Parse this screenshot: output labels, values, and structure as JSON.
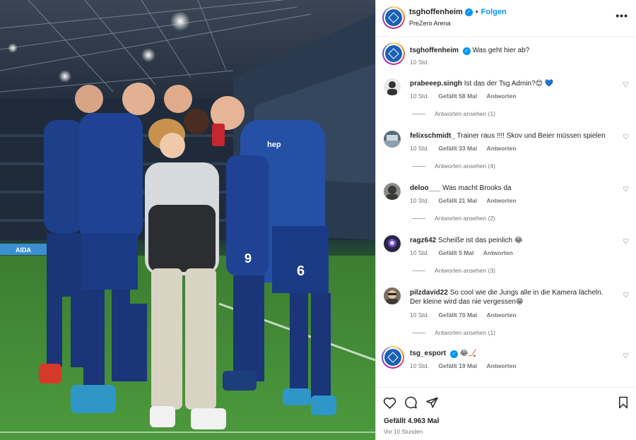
{
  "post": {
    "username": "tsghoffenheim",
    "follow_label": "Folgen",
    "location": "PreZero Arena",
    "more_label": "•••"
  },
  "caption": {
    "username": "tsghoffenheim",
    "text": "Was geht hier ab?",
    "time": "10 Std."
  },
  "comments": [
    {
      "username": "prabeeep.singh",
      "text": "Ist das der Tsg Admin?😊 💙",
      "time": "10 Std.",
      "likes": "Gefällt 58 Mal",
      "reply": "Antworten",
      "view_replies": "Antworten ansehen (1)",
      "avatar_color": "#e8e8e8"
    },
    {
      "username": "felixschmidt_",
      "text": "Trainer raus !!!! Skov und Beier müssen spielen",
      "time": "10 Std.",
      "likes": "Gefällt 33 Mal",
      "reply": "Antworten",
      "view_replies": "Antworten ansehen (4)",
      "avatar_color": "#5a6b7c"
    },
    {
      "username": "deloo___",
      "text": "Was macht Brooks da",
      "time": "10 Std.",
      "likes": "Gefällt 21 Mal",
      "reply": "Antworten",
      "view_replies": "Antworten ansehen (2)",
      "avatar_color": "#8a8f88"
    },
    {
      "username": "ragz642",
      "text": "Scheiße ist das peinlich 😂",
      "time": "10 Std.",
      "likes": "Gefällt 5 Mal",
      "reply": "Antworten",
      "view_replies": "Antworten ansehen (3)",
      "avatar_color": "#2a2540"
    },
    {
      "username": "pilzdavid22",
      "text": "So cool wie die Jungs alle in die Kamera lächeln. Der kleine wird das nie vergessen😁",
      "time": "10 Std.",
      "likes": "Gefällt 70 Mal",
      "reply": "Antworten",
      "view_replies": "Antworten ansehen (1)",
      "avatar_color": "#7c6f60"
    },
    {
      "username": "tsg_esport",
      "text": "😂🏒",
      "time": "10 Std.",
      "likes": "Gefällt 19 Mal",
      "reply": "Antworten",
      "view_replies": "",
      "avatar_color": "#1961b5"
    }
  ],
  "actions": {
    "likes": "Gefällt 4.963 Mal",
    "time_ago": "Vor 10 Stunden"
  },
  "photo": {
    "ad_board_text": "AIDA",
    "sponsor_text": "hep",
    "jersey_numbers": [
      "9",
      "6"
    ]
  }
}
